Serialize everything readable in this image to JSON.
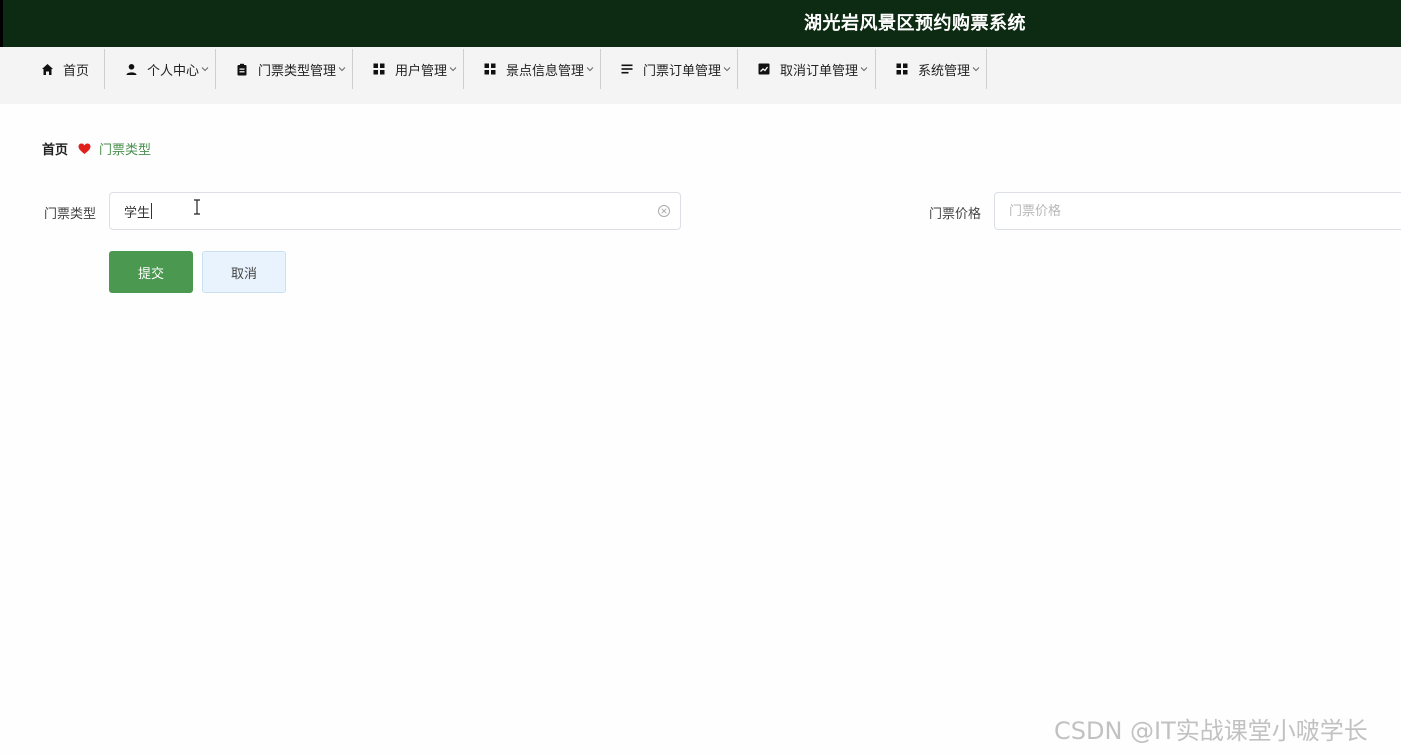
{
  "header": {
    "title": "湖光岩风景区预约购票系统",
    "bg_color": "#0d2a12"
  },
  "nav": {
    "items": [
      {
        "label": "首页",
        "icon": "home-icon",
        "has_dropdown": false
      },
      {
        "label": "个人中心",
        "icon": "user-icon",
        "has_dropdown": true
      },
      {
        "label": "门票类型管理",
        "icon": "clipboard-icon",
        "has_dropdown": true
      },
      {
        "label": "用户管理",
        "icon": "grid-icon",
        "has_dropdown": true
      },
      {
        "label": "景点信息管理",
        "icon": "grid-icon",
        "has_dropdown": true
      },
      {
        "label": "门票订单管理",
        "icon": "list-icon",
        "has_dropdown": true
      },
      {
        "label": "取消订单管理",
        "icon": "chart-icon",
        "has_dropdown": true
      },
      {
        "label": "系统管理",
        "icon": "grid-icon",
        "has_dropdown": true
      }
    ]
  },
  "breadcrumb": {
    "home": "首页",
    "separator_icon": "heart-icon",
    "current": "门票类型"
  },
  "form": {
    "ticket_type": {
      "label": "门票类型",
      "value": "学生",
      "placeholder": "门票类型"
    },
    "ticket_price": {
      "label": "门票价格",
      "value": "",
      "placeholder": "门票价格"
    },
    "submit_label": "提交",
    "cancel_label": "取消"
  },
  "watermark": "CSDN @IT实战课堂小啵学长",
  "colors": {
    "accent": "#4b9850",
    "breadcrumb_current": "#4a8f4f",
    "cancel_bg": "#e9f3fd"
  }
}
